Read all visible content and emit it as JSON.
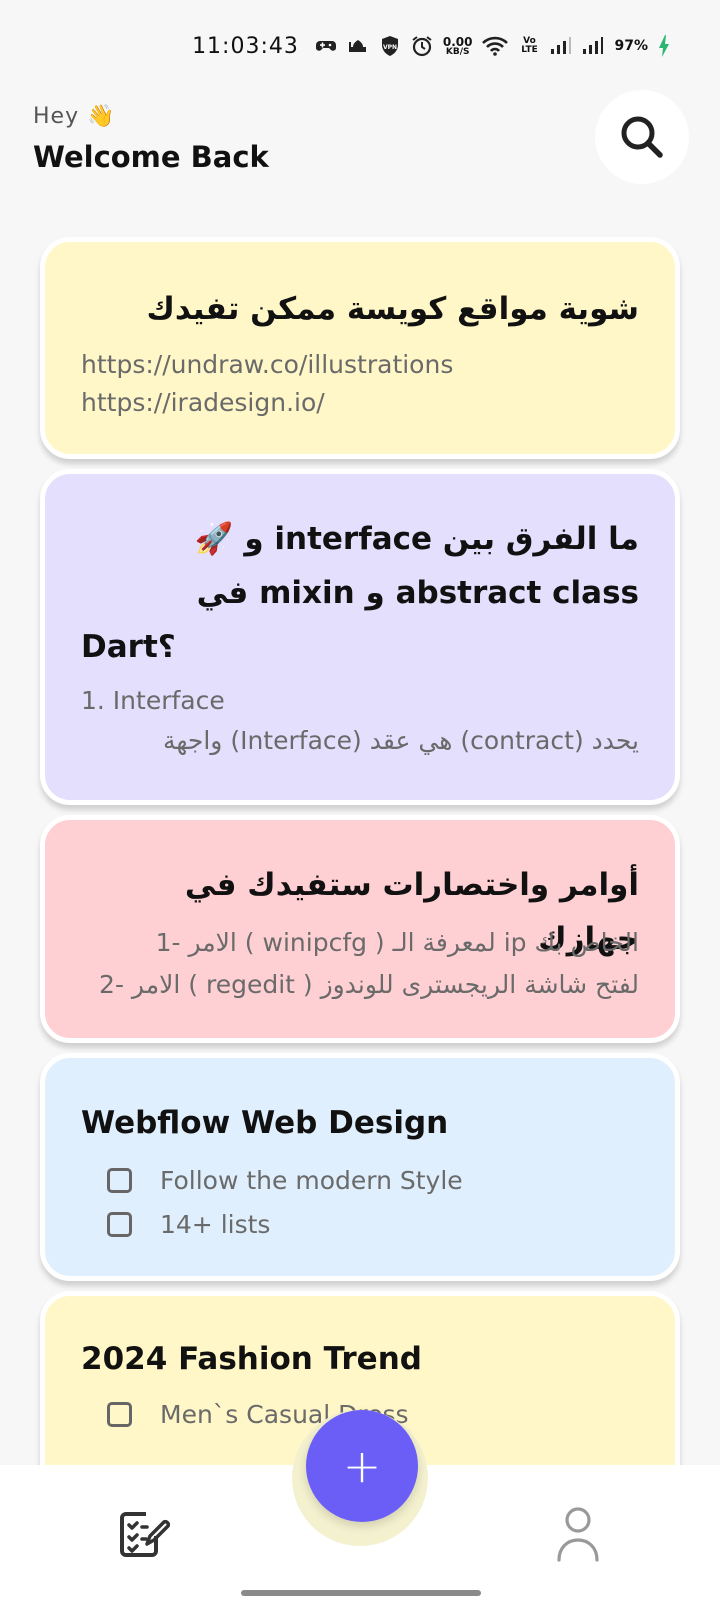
{
  "status_bar": {
    "time": "11:03:43",
    "network_speed_value": "0.00",
    "network_speed_unit": "KB/S",
    "vpn_label": "VPN",
    "volte_label": "Vo LTE",
    "battery_percent": "97%"
  },
  "header": {
    "greeting": "Hey 👋",
    "title": "Welcome Back",
    "search_icon": "search-icon"
  },
  "notes": [
    {
      "type": "text",
      "color": "#fff7c7",
      "title": "شوية مواقع كويسة ممكن تفيدك",
      "lines": [
        "https://undraw.co/illustrations",
        "https://iradesign.io/"
      ]
    },
    {
      "type": "text",
      "color": "#e3dffd",
      "title_line1": "ما الفرق بين interface و 🚀",
      "title_line2": "abstract class و mixin في",
      "title_line3": "Dart؟",
      "lines": [
        "1. Interface",
        "يحدد (contract) هي عقد (Interface) واجهة"
      ]
    },
    {
      "type": "text",
      "color": "#ffd0d3",
      "title": "أوامر واختصارات ستفيدك في جهازك",
      "lines": [
        "الخاص بك ip لمعرفة الـ ( winipcfg ) الامر -1",
        "لفتح شاشة الريجسترى للوندوز ( regedit ) الامر -2"
      ]
    },
    {
      "type": "checklist",
      "color": "#dfeffe",
      "title": "Webflow Web Design",
      "items": [
        "Follow the modern Style",
        "14+ lists"
      ]
    },
    {
      "type": "checklist",
      "color": "#fff7c7",
      "title": "2024 Fashion Trend",
      "items": [
        "Men`s Casual Dress"
      ]
    }
  ],
  "bottom_nav": {
    "fab_label": "+",
    "fab_color": "#6a5ef7",
    "notes_icon": "notes-icon",
    "profile_icon": "profile-icon"
  }
}
